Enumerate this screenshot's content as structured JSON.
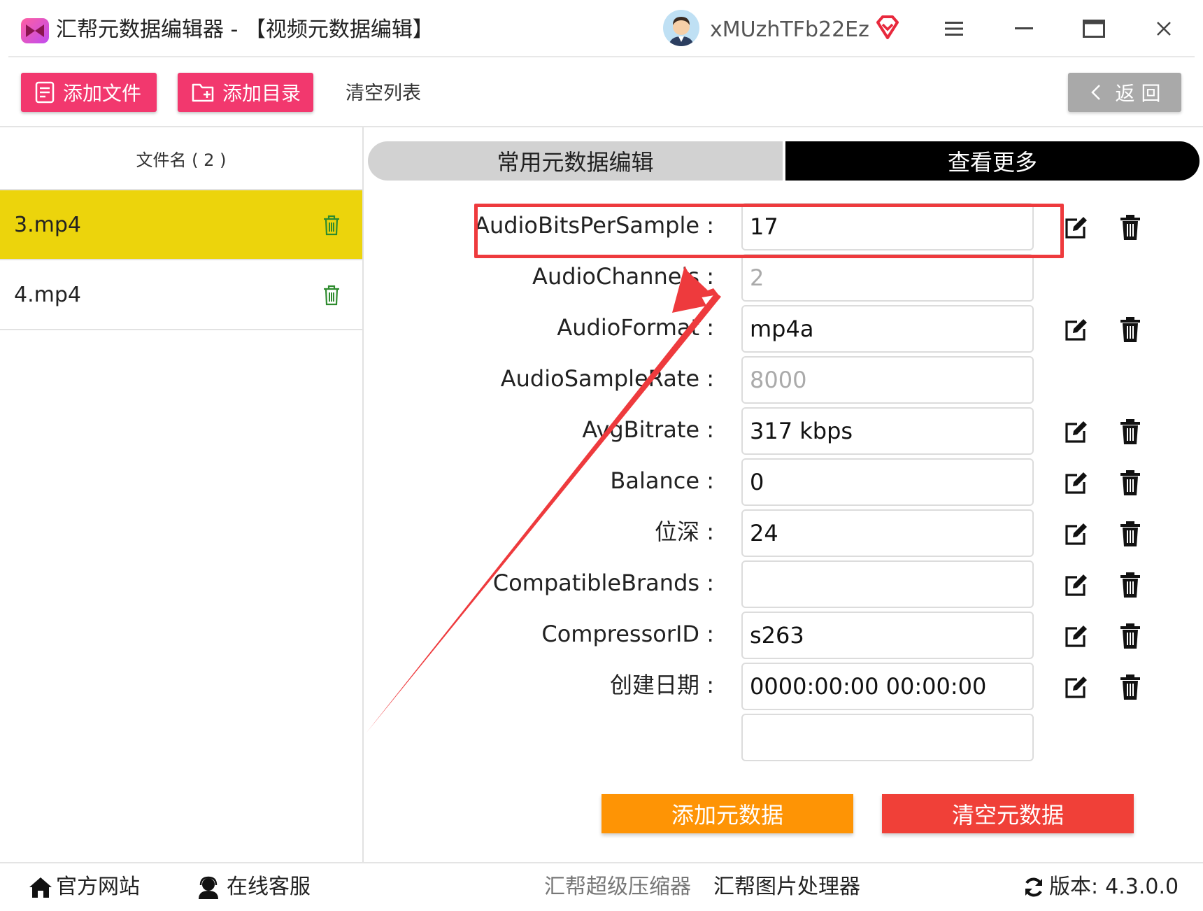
{
  "app": {
    "title": "汇帮元数据编辑器 - 【视频元数据编辑】",
    "username": "xMUzhTFb22Ez"
  },
  "toolbar": {
    "add_file": "添加文件",
    "add_folder": "添加目录",
    "clear_list": "清空列表",
    "back": "返 回"
  },
  "sidebar": {
    "header": "文件名 ( 2 )",
    "files": [
      {
        "name": "3.mp4",
        "selected": true
      },
      {
        "name": "4.mp4",
        "selected": false
      }
    ]
  },
  "tabs": {
    "common": "常用元数据编辑",
    "more": "查看更多"
  },
  "fields": [
    {
      "label": "AudioBitsPerSample :",
      "value": "17",
      "editable": true
    },
    {
      "label": "AudioChannels :",
      "value": "2",
      "editable": false
    },
    {
      "label": "AudioFormat :",
      "value": "mp4a",
      "editable": true
    },
    {
      "label": "AudioSampleRate :",
      "value": "8000",
      "editable": false
    },
    {
      "label": "AvgBitrate :",
      "value": "317 kbps",
      "editable": true
    },
    {
      "label": "Balance :",
      "value": "0",
      "editable": true
    },
    {
      "label": "位深 :",
      "value": "24",
      "editable": true
    },
    {
      "label": "CompatibleBrands :",
      "value": "",
      "editable": true
    },
    {
      "label": "CompressorID :",
      "value": "s263",
      "editable": true
    },
    {
      "label": "创建日期 :",
      "value": "0000:00:00 00:00:00",
      "editable": true
    }
  ],
  "actions": {
    "add_metadata": "添加元数据",
    "clear_metadata": "清空元数据"
  },
  "footer": {
    "website": "官方网站",
    "support": "在线客服",
    "compressor": "汇帮超级压缩器",
    "image_tool": "汇帮图片处理器",
    "version_label": "版本:",
    "version": "4.3.0.0"
  },
  "colors": {
    "pink": "#f2386e",
    "selected_row": "#ecd40c",
    "orange": "#fe9405",
    "red": "#f04038",
    "annotation": "#ee3a3d"
  }
}
